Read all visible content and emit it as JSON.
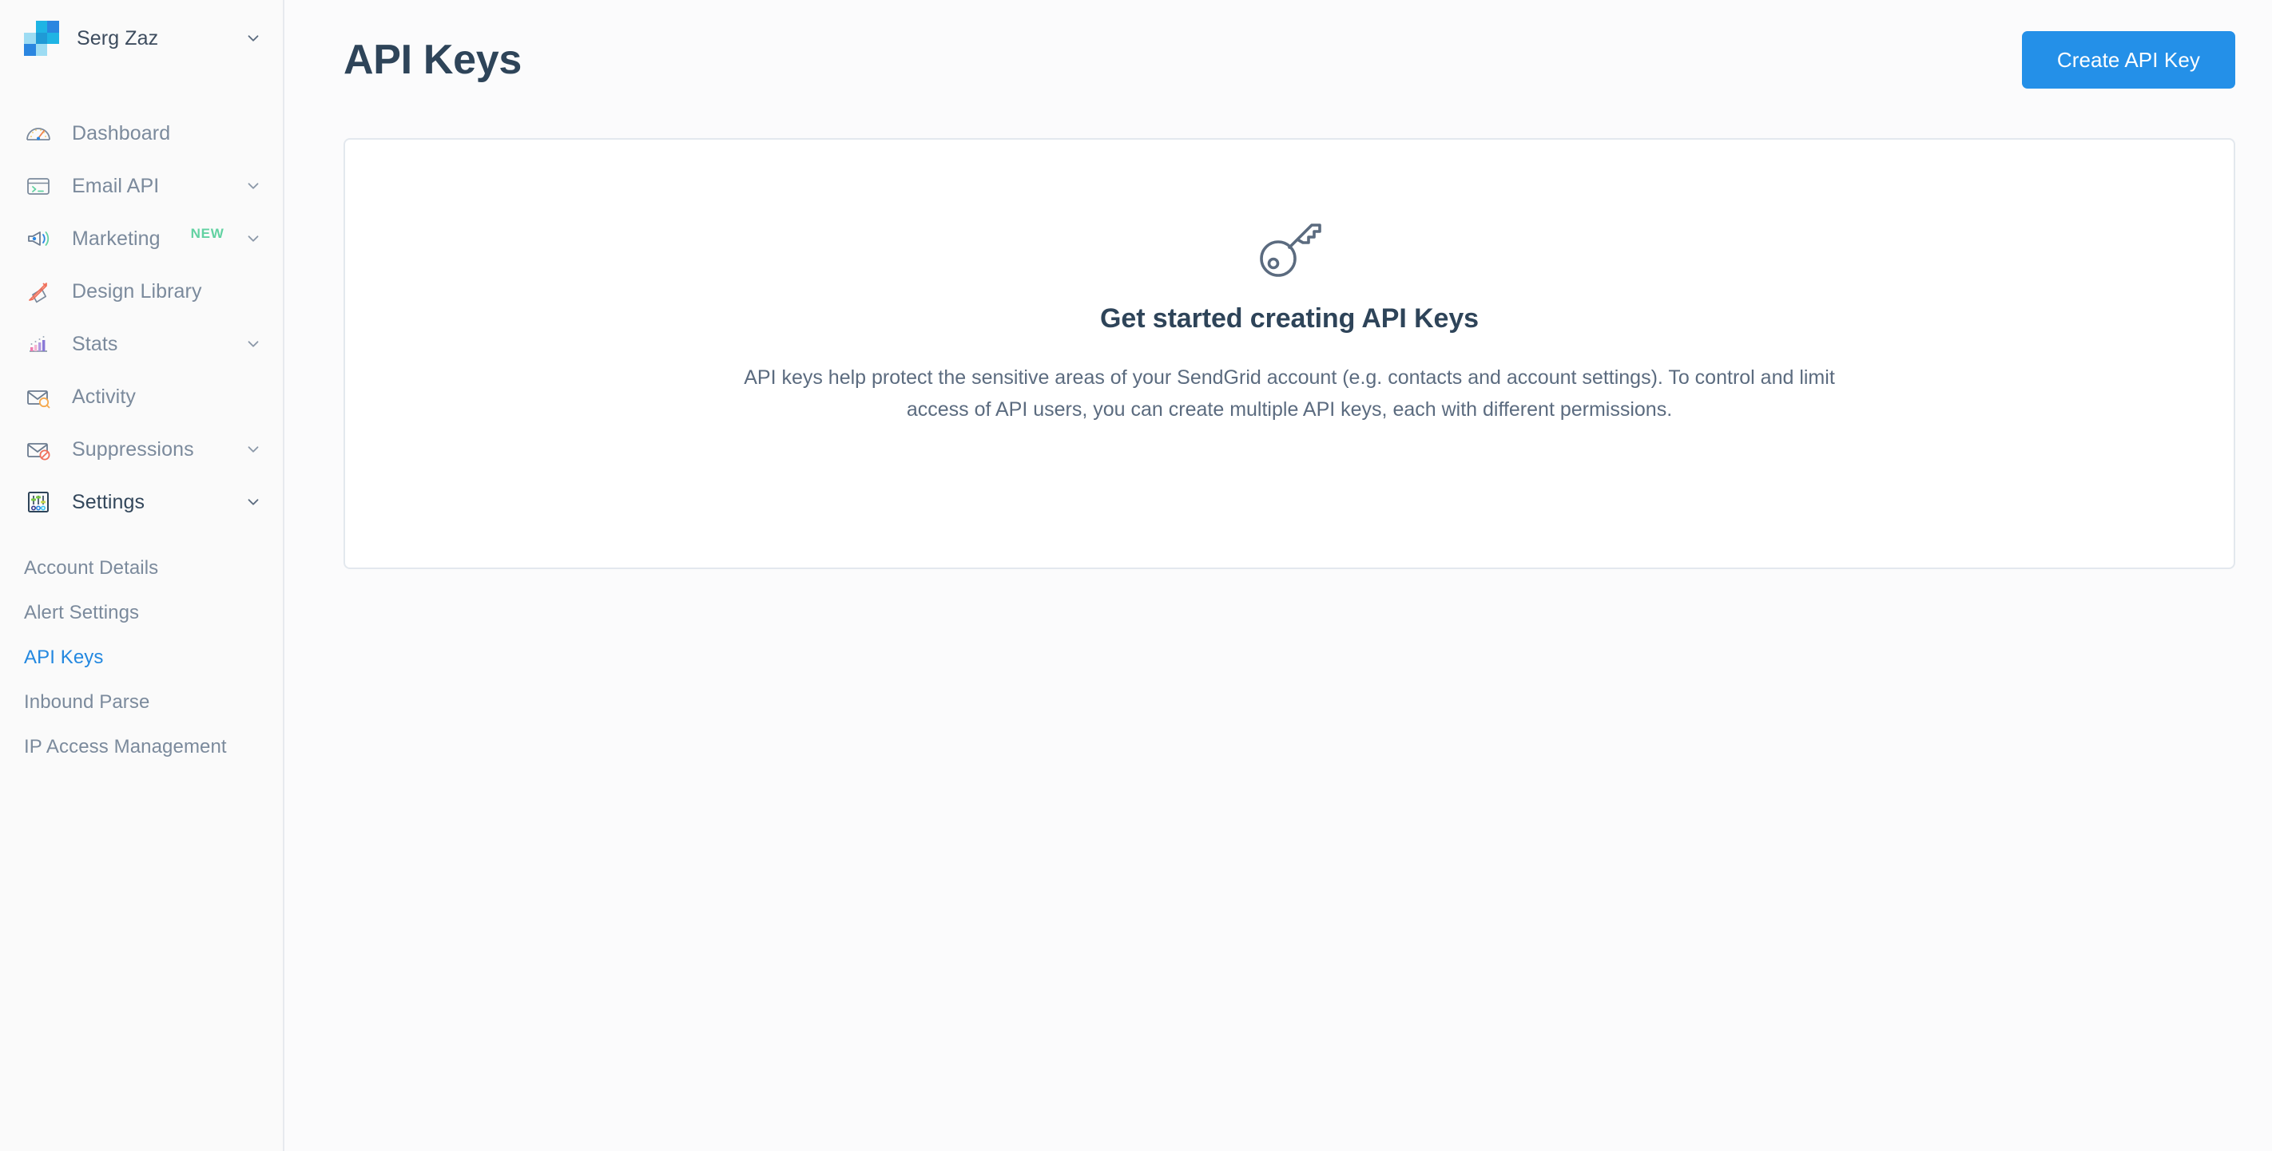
{
  "brand": {
    "name": "Serg Zaz",
    "logo_icon": "sendgrid-logo-icon",
    "caret_icon": "chevron-down-icon",
    "logo_colors": [
      "#8fd8f2",
      "#1fb4e4",
      "#2a86e0",
      "#1f9ad6",
      "#2a86e0",
      "#9ddcf3"
    ]
  },
  "sidebar": {
    "items": [
      {
        "label": "Dashboard",
        "icon": "gauge-icon",
        "has_caret": false,
        "badge": "",
        "active": false
      },
      {
        "label": "Email API",
        "icon": "terminal-icon",
        "has_caret": true,
        "badge": "",
        "active": false
      },
      {
        "label": "Marketing",
        "icon": "megaphone-icon",
        "has_caret": true,
        "badge": "NEW",
        "active": false
      },
      {
        "label": "Design Library",
        "icon": "pencil-ruler-icon",
        "has_caret": false,
        "badge": "",
        "active": false
      },
      {
        "label": "Stats",
        "icon": "bar-chart-icon",
        "has_caret": true,
        "badge": "",
        "active": false
      },
      {
        "label": "Activity",
        "icon": "envelope-search-icon",
        "has_caret": false,
        "badge": "",
        "active": false
      },
      {
        "label": "Suppressions",
        "icon": "envelope-blocked-icon",
        "has_caret": true,
        "badge": "",
        "active": false
      },
      {
        "label": "Settings",
        "icon": "sliders-icon",
        "has_caret": true,
        "badge": "",
        "active": true
      }
    ],
    "subitems": [
      {
        "label": "Account Details",
        "active": false
      },
      {
        "label": "Alert Settings",
        "active": false
      },
      {
        "label": "API Keys",
        "active": true
      },
      {
        "label": "Inbound Parse",
        "active": false
      },
      {
        "label": "IP Access Management",
        "active": false
      }
    ]
  },
  "header": {
    "title": "API Keys",
    "create_button_label": "Create API Key"
  },
  "empty_state": {
    "icon": "key-icon",
    "title": "Get started creating API Keys",
    "description": "API keys help protect the sensitive areas of your SendGrid account (e.g. contacts and account settings). To control and limit access of API users, you can create multiple API keys, each with different permissions."
  },
  "colors": {
    "accent": "#2490e8",
    "active_link": "#2388e0",
    "badge_new": "#62d2a2",
    "title": "#2e4459",
    "muted_text": "#7b8a9c",
    "background": "#fbfbfc",
    "card_border": "#e3e8ee"
  }
}
